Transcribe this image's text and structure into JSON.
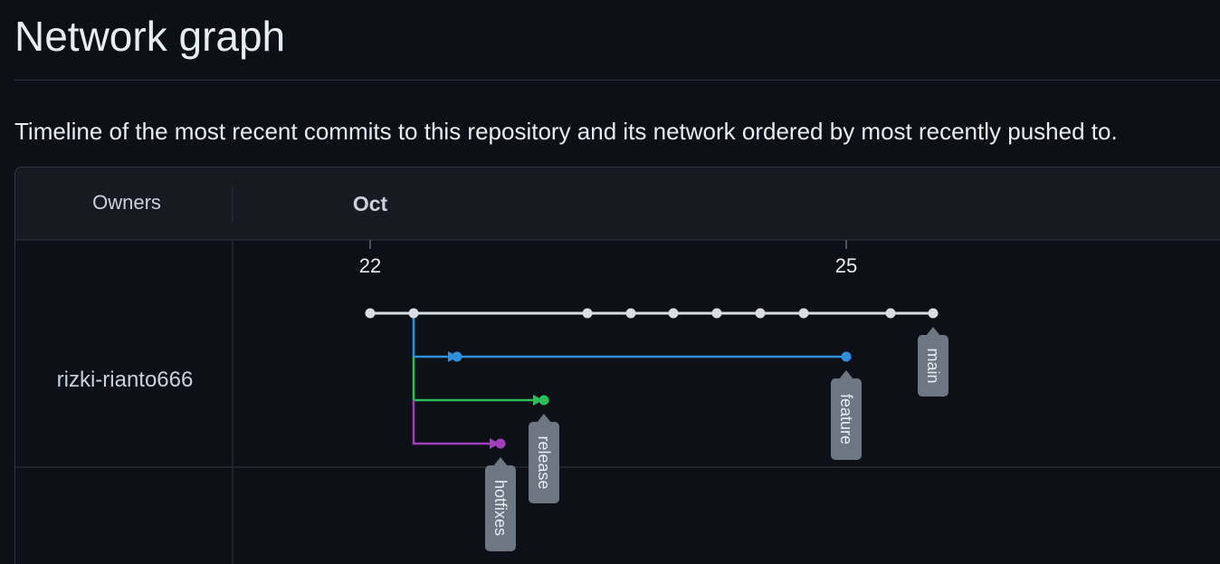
{
  "page": {
    "title": "Network graph",
    "description": "Timeline of the most recent commits to this repository and its network ordered by most recently pushed to."
  },
  "graph": {
    "owners_header": "Owners",
    "month_label": "Oct",
    "date_ticks": [
      "22",
      "25"
    ],
    "owners": [
      "rizki-rianto666"
    ],
    "branches": [
      {
        "name": "main",
        "color": "#d8dee4"
      },
      {
        "name": "feature",
        "color": "#2f8fdc"
      },
      {
        "name": "release",
        "color": "#2ebd59"
      },
      {
        "name": "hotfixes",
        "color": "#a040b8"
      }
    ],
    "colors": {
      "background": "#0d1117",
      "header_bg": "#161b22",
      "border": "#30363d",
      "label_bg": "#6e7681"
    }
  }
}
